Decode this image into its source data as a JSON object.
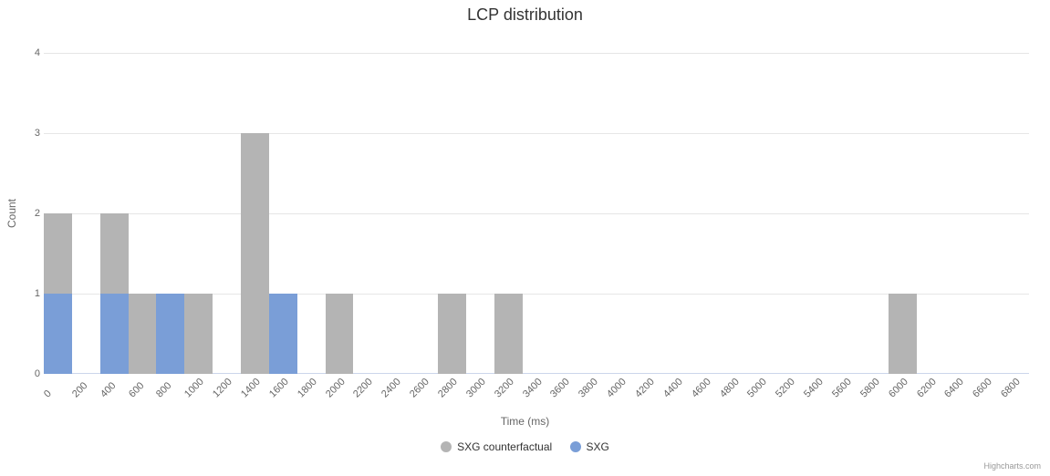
{
  "chart_data": {
    "type": "bar",
    "title": "LCP distribution",
    "xlabel": "Time (ms)",
    "ylabel": "Count",
    "ylim": [
      0,
      4
    ],
    "yticks": [
      0,
      1,
      2,
      3,
      4
    ],
    "categories": [
      0,
      200,
      400,
      600,
      800,
      1000,
      1200,
      1400,
      1600,
      1800,
      2000,
      2200,
      2400,
      2600,
      2800,
      3000,
      3200,
      3400,
      3600,
      3800,
      4000,
      4200,
      4400,
      4600,
      4800,
      5000,
      5200,
      5400,
      5600,
      5800,
      6000,
      6200,
      6400,
      6600,
      6800
    ],
    "series": [
      {
        "name": "SXG counterfactual",
        "color": "#b4b4b4",
        "values": [
          2,
          0,
          2,
          1,
          1,
          1,
          0,
          3,
          0,
          0,
          1,
          0,
          0,
          0,
          1,
          0,
          1,
          0,
          0,
          0,
          0,
          0,
          0,
          0,
          0,
          0,
          0,
          0,
          0,
          0,
          1,
          0,
          0,
          0,
          0
        ]
      },
      {
        "name": "SXG",
        "color": "#7a9ed7",
        "values": [
          1,
          0,
          1,
          0,
          1,
          0,
          0,
          0,
          1,
          0,
          0,
          0,
          0,
          0,
          0,
          0,
          0,
          0,
          0,
          0,
          0,
          0,
          0,
          0,
          0,
          0,
          0,
          0,
          0,
          0,
          0,
          0,
          0,
          0,
          0
        ]
      }
    ],
    "legend_position": "bottom",
    "credit": "Highcharts.com"
  }
}
